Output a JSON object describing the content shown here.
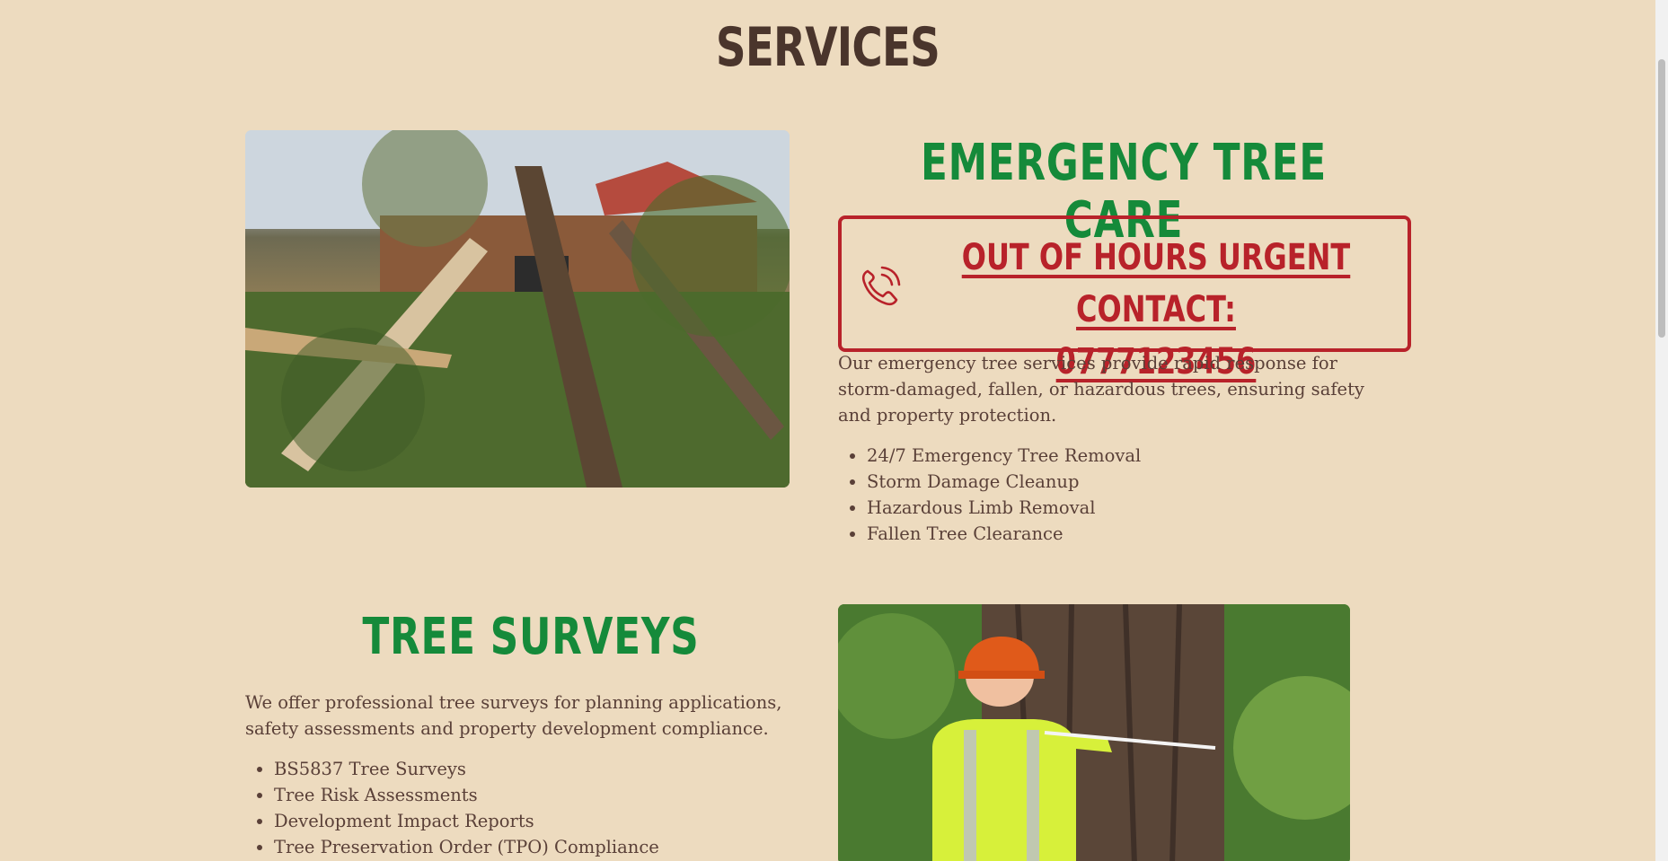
{
  "page": {
    "title": "SERVICES"
  },
  "emergency": {
    "heading": "EMERGENCY TREE CARE",
    "urgent_contact_label": "OUT OF HOURS URGENT CONTACT:",
    "urgent_contact_phone": "0777123456",
    "description": "Our emergency tree services provide rapid response for storm-damaged, fallen, or hazardous trees, ensuring safety and property protection.",
    "items": [
      "24/7 Emergency Tree Removal",
      "Storm Damage Cleanup",
      "Hazardous Limb Removal",
      "Fallen Tree Clearance"
    ],
    "icon": "phone-ringing-icon"
  },
  "surveys": {
    "heading": "TREE SURVEYS",
    "description": "We offer professional tree surveys for planning applications, safety assessments and property development compliance.",
    "items": [
      "BS5837 Tree Surveys",
      "Tree Risk Assessments",
      "Development Impact Reports",
      "Tree Preservation Order (TPO) Compliance"
    ]
  },
  "colors": {
    "background": "#eddbbf",
    "heading_green": "#158a3a",
    "urgent_red": "#b8222a",
    "title_brown": "#4a352c",
    "text_brown": "#5a4038"
  }
}
